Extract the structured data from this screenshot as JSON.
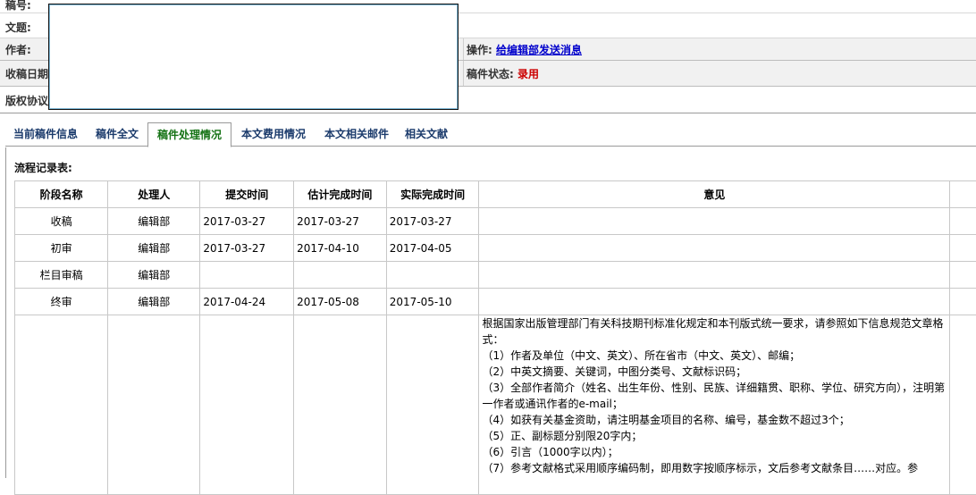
{
  "info": {
    "manuscript_no_label": "稿号:",
    "title_label": "文题:",
    "author_label": "作者:",
    "received_date_label": "收稿日期",
    "copyright_label": "版权协议",
    "operation_label": "操作:",
    "operation_link": "给编辑部发送消息",
    "status_label": "稿件状态:",
    "status_value": "录用"
  },
  "tabs": [
    {
      "label": "当前稿件信息",
      "active": false
    },
    {
      "label": "稿件全文",
      "active": false
    },
    {
      "label": "稿件处理情况",
      "active": true
    },
    {
      "label": "本文费用情况",
      "active": false
    },
    {
      "label": "本文相关邮件",
      "active": false
    },
    {
      "label": "相关文献",
      "active": false
    }
  ],
  "flow": {
    "title": "流程记录表:",
    "headers": [
      "阶段名称",
      "处理人",
      "提交时间",
      "估计完成时间",
      "实际完成时间",
      "意见"
    ],
    "rows": [
      [
        "收稿",
        "编辑部",
        "2017-03-27",
        "2017-03-27",
        "2017-03-27",
        ""
      ],
      [
        "初审",
        "编辑部",
        "2017-03-27",
        "2017-04-10",
        "2017-04-05",
        ""
      ],
      [
        "栏目审稿",
        "编辑部",
        "",
        "",
        "",
        ""
      ],
      [
        "终审",
        "编辑部",
        "2017-04-24",
        "2017-05-08",
        "2017-05-10",
        ""
      ]
    ],
    "opinion_lines": [
      "根据国家出版管理部门有关科技期刊标准化规定和本刊版式统一要求，请参照如下信息规范文章格",
      "式：",
      "（1）作者及单位（中文、英文）、所在省市（中文、英文）、邮编；",
      "（2）中英文摘要、关键词，中图分类号、文献标识码；",
      "（3）全部作者简介（姓名、出生年份、性别、民族、详细籍贯、职称、学位、研究方向），注明第",
      "一作者或通讯作者的e-mail；",
      "（4）如获有关基金资助，请注明基金项目的名称、编号，基金数不超过3个；",
      "（5）正、副标题分别限20字内；",
      "（6）引言（1000字以内）；",
      "（7）参考文献格式采用顺序编码制，即用数字按顺序标示，文后参考文献条目……对应。参"
    ]
  }
}
